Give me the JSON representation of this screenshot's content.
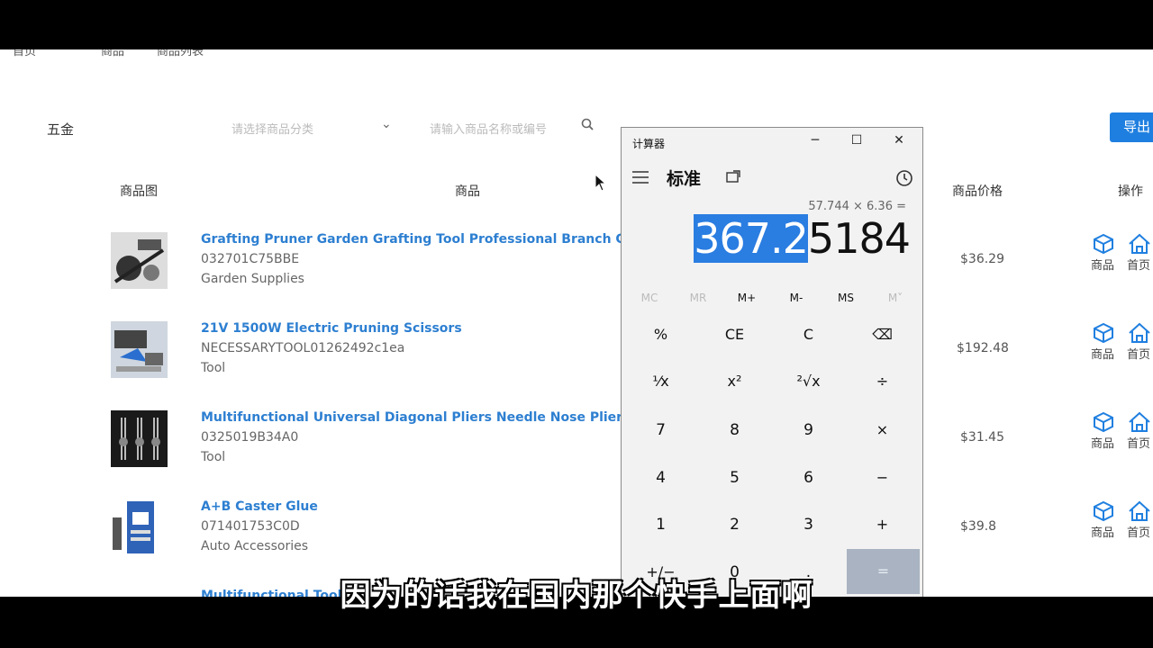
{
  "top_nav": [
    "首页",
    "商品",
    "商品列表"
  ],
  "filters": {
    "category_label": "五金",
    "select_placeholder": "请选择商品分类",
    "search_placeholder": "请输入商品名称或编号",
    "export_label": "导出"
  },
  "table": {
    "headers": {
      "image": "商品图",
      "product": "商品",
      "price": "商品价格",
      "actions": "操作"
    },
    "rows": [
      {
        "name": "Grafting Pruner Garden Grafting Tool Professional Branch Cutter Secateur",
        "sku": "032701C75BBE",
        "category": "Garden Supplies",
        "price": "$36.29"
      },
      {
        "name": "21V 1500W Electric Pruning Scissors",
        "sku": "NECESSARYTOOL01262492c1ea",
        "category": "Tool",
        "price": "$192.48"
      },
      {
        "name": "Multifunctional Universal Diagonal Pliers Needle Nose Pliers Hardware",
        "sku": "0325019B34A0",
        "category": "Tool",
        "price": "$31.45"
      },
      {
        "name": "A+B Caster Glue",
        "sku": "071401753C0D",
        "category": "Auto Accessories",
        "price": "$39.8"
      }
    ],
    "next_row_partial": "Multifunctional Tool",
    "action_labels": {
      "product": "商品",
      "home": "首页"
    }
  },
  "calculator": {
    "title": "计算器",
    "mode": "标准",
    "expression": "57.744 × 6.36 =",
    "display_selected": "367.2",
    "display_rest": "5184",
    "memory": [
      "MC",
      "MR",
      "M+",
      "M-",
      "MS",
      "M˅"
    ],
    "keys": [
      [
        "%",
        "CE",
        "C",
        "⌫"
      ],
      [
        "⅟x",
        "x²",
        "²√x",
        "÷"
      ],
      [
        "7",
        "8",
        "9",
        "×"
      ],
      [
        "4",
        "5",
        "6",
        "−"
      ],
      [
        "1",
        "2",
        "3",
        "+"
      ],
      [
        "+/−",
        "0",
        ".",
        "="
      ]
    ]
  },
  "subtitle": "因为的话我在国内那个快手上面啊",
  "colors": {
    "accent": "#1f7fe0",
    "link": "#2d7fd1",
    "selection": "#2a7de1"
  }
}
